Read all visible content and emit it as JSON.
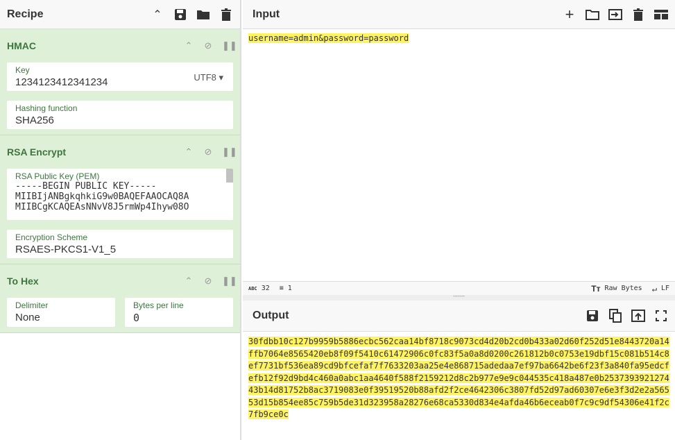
{
  "recipe": {
    "title": "Recipe",
    "hmac": {
      "title": "HMAC",
      "key_label": "Key",
      "key_value": "1234123412341234",
      "encoding": "UTF8",
      "hash_label": "Hashing function",
      "hash_value": "SHA256"
    },
    "rsa": {
      "title": "RSA Encrypt",
      "key_label": "RSA Public Key (PEM)",
      "key_lines": [
        "-----BEGIN PUBLIC KEY-----",
        "MIIBIjANBgkqhkiG9w0BAQEFAAOCAQ8A",
        "MIIBCgKCAQEAsNNvV8J5rmWp4Ihyw08O"
      ],
      "scheme_label": "Encryption Scheme",
      "scheme_value": "RSAES-PKCS1-V1_5"
    },
    "tohex": {
      "title": "To Hex",
      "delim_label": "Delimiter",
      "delim_value": "None",
      "bpl_label": "Bytes per line",
      "bpl_value": "0"
    }
  },
  "input": {
    "title": "Input",
    "text": "username=admin&password=password",
    "chars": "32",
    "lines": "1",
    "encoding": "Raw Bytes",
    "eol": "LF"
  },
  "output": {
    "title": "Output",
    "text": "30fdbb10c127b9959b5886ecbc562caa14bf8718c9073cd4d20b2cd0b433a02d60f252d51e8443720a14ffb7064e8565420eb8f09f5410c61472906c0fc83f5a0a8d0200c261812b0c0753e19dbf15c081b514c8ef7731bf536ea89cd9bfcefaf7f7633203aa25e4e868715adedaa7ef97ba6642be6f23f3a840fa95edcfefb12f92d9bd4c460a0abc1aa4640f588f2159212d8c2b977e9e9c044535c418a487e0b253739392127443b14d81752b8ac3719083e0f39519520b88afd2f2ce4642306c3807fd52d97ad60307e6e3f3d2e2a56553d15b854ee85c759b5de31d323958a28276e68ca5330d834e4afda46b6eceab0f7c9c9df54306e41f2c7fb9ce0c"
  }
}
